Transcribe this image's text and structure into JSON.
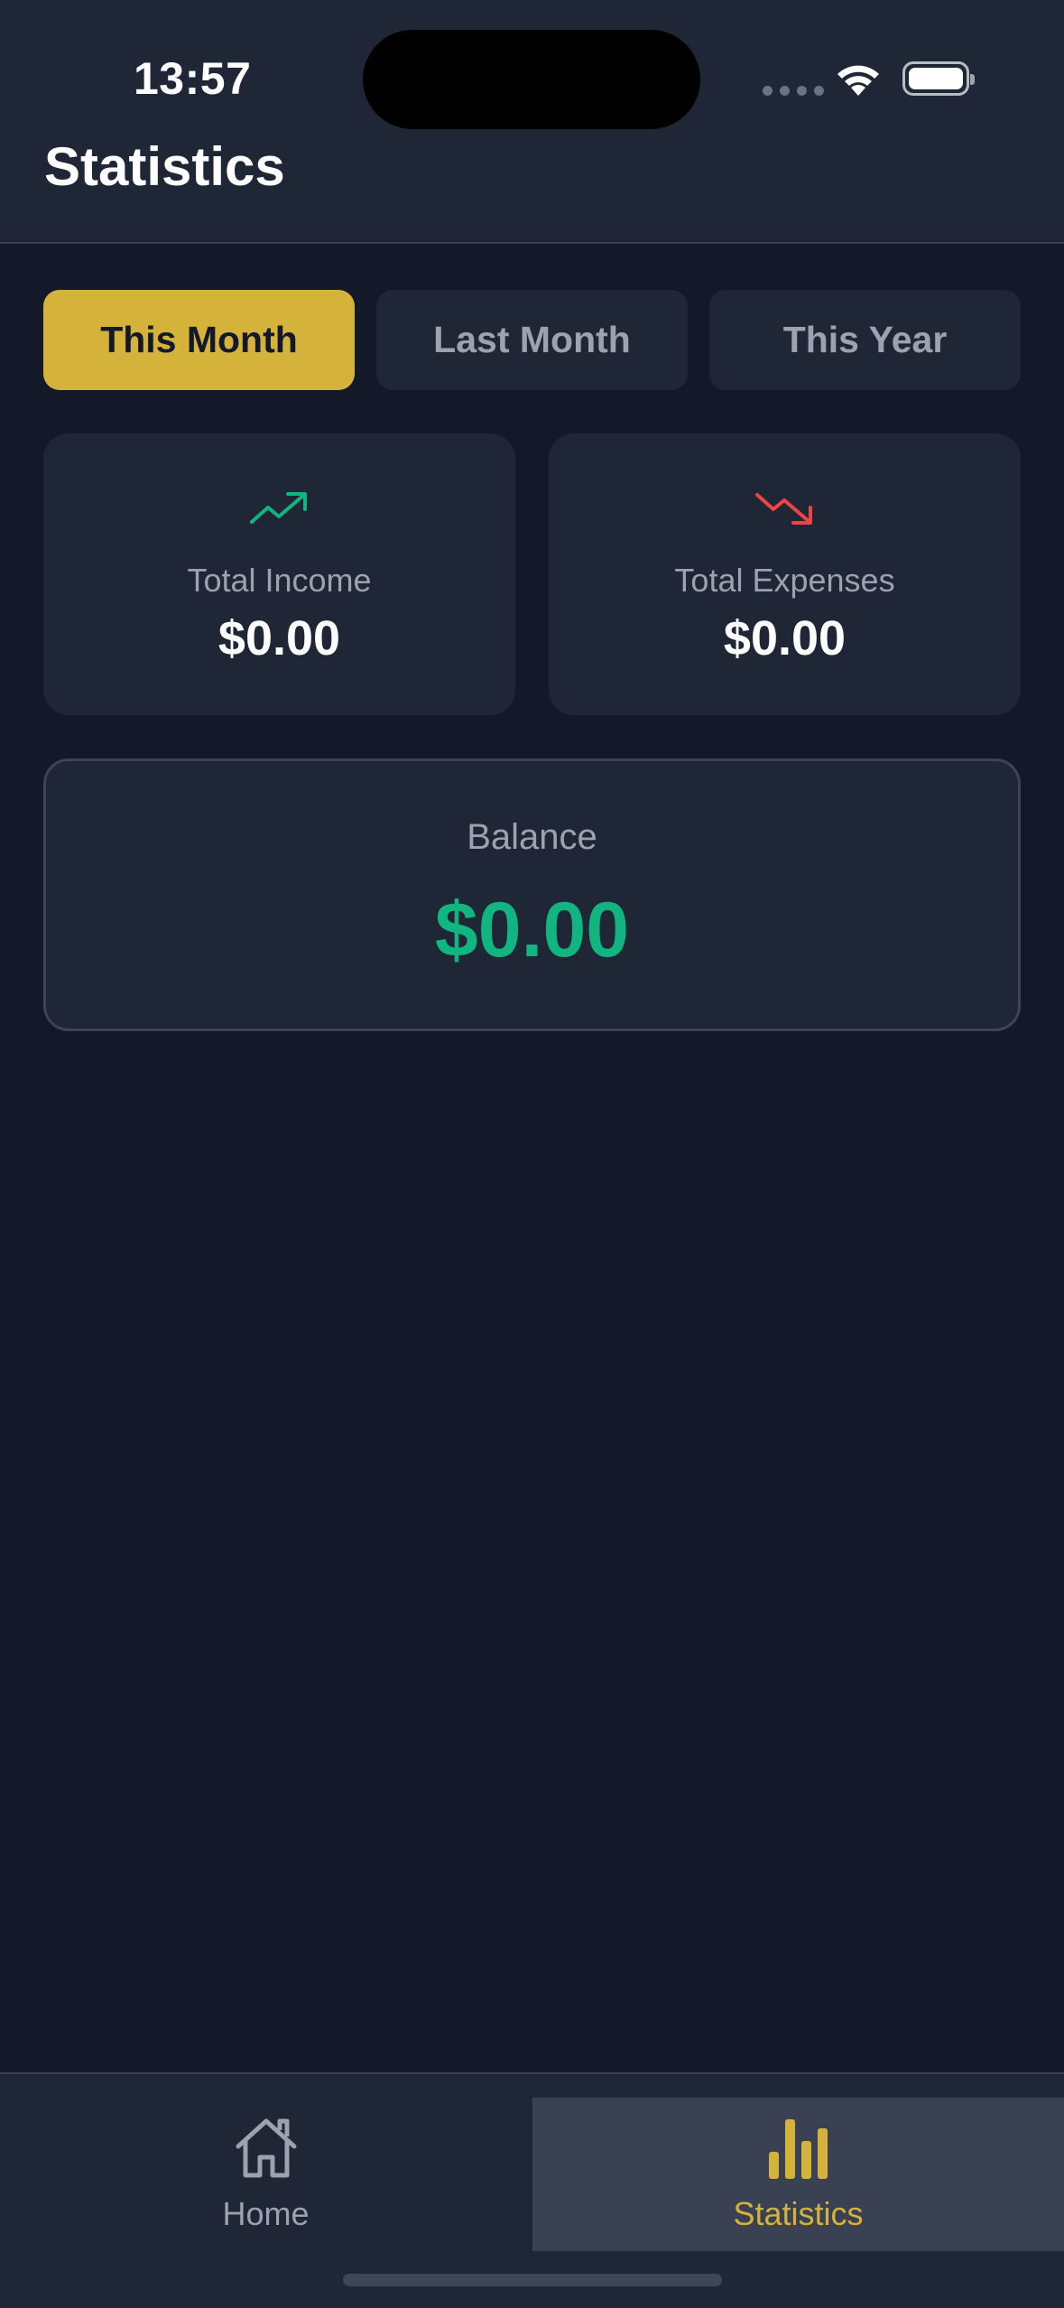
{
  "status_bar": {
    "time": "13:57"
  },
  "header": {
    "title": "Statistics"
  },
  "period_tabs": [
    {
      "label": "This Month",
      "active": true
    },
    {
      "label": "Last Month",
      "active": false
    },
    {
      "label": "This Year",
      "active": false
    }
  ],
  "summary": {
    "income": {
      "label": "Total Income",
      "amount": "$0.00",
      "icon": "trending-up-icon",
      "color": "#10b57f"
    },
    "expenses": {
      "label": "Total Expenses",
      "amount": "$0.00",
      "icon": "trending-down-icon",
      "color": "#ef4444"
    }
  },
  "balance": {
    "label": "Balance",
    "amount": "$0.00",
    "color": "#10b57f"
  },
  "tab_bar": {
    "items": [
      {
        "label": "Home",
        "icon": "home-icon",
        "active": false
      },
      {
        "label": "Statistics",
        "icon": "bar-chart-icon",
        "active": true
      }
    ]
  },
  "colors": {
    "accent": "#d5b23a",
    "background": "#131929",
    "surface": "#1f2636"
  }
}
